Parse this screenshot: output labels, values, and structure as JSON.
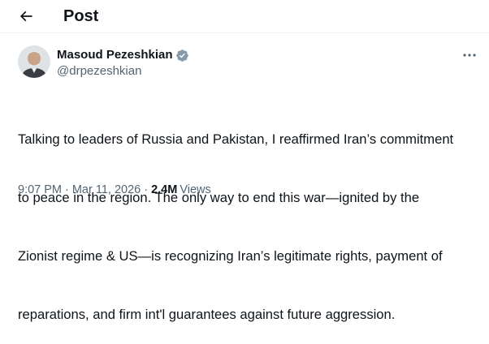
{
  "header": {
    "title": "Post",
    "back_icon": "arrow-left-icon"
  },
  "author": {
    "display_name": "Masoud Pezeshkian",
    "handle": "@drpezeshkian",
    "verified": true,
    "verified_icon": "verified-badge-icon",
    "verified_color": "#829aab"
  },
  "menu": {
    "more_icon": "more-horizontal-icon"
  },
  "post": {
    "lines": [
      "Talking to leaders of Russia and Pakistan, I reaffirmed Iran’s commitment",
      "to peace in the region. The only way to end this war—ignited by the",
      "Zionist regime & US—is recognizing Iran’s legitimate rights, payment of",
      "reparations, and firm int'l guarantees against future aggression."
    ]
  },
  "meta": {
    "time": "9:07 PM",
    "dot": "·",
    "date": "Mar 11, 2026",
    "views_count": "2.4M",
    "views_label": "Views"
  },
  "colors": {
    "text": "#0f1419",
    "secondary": "#536471",
    "divider": "#eff3f4"
  }
}
